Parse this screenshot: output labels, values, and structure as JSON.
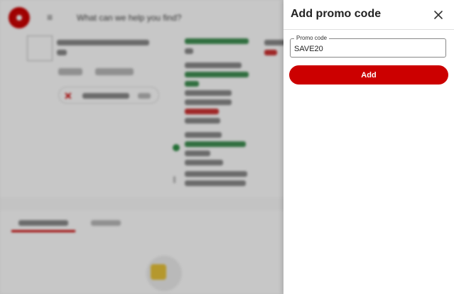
{
  "background": {
    "search_text": "What can we help you find?"
  },
  "drawer": {
    "title": "Add promo code",
    "field": {
      "label": "Promo code",
      "value": "SAVE20"
    },
    "add_label": "Add"
  },
  "colors": {
    "accent": "#cc0000",
    "drawer_bg": "#ffffff",
    "scrim": "rgba(0,0,0,0.22)"
  },
  "icons": {
    "close": "close-icon",
    "logo": "target-logo"
  }
}
